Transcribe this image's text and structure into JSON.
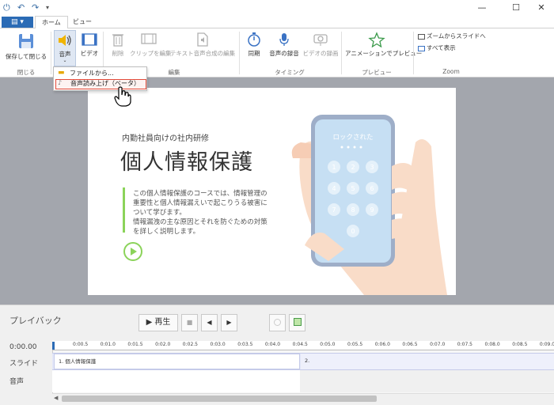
{
  "window": {
    "quick_access": [
      "⏻",
      "↶",
      "↷",
      "▾"
    ],
    "minimize": "—",
    "maximize": "☐",
    "close": "✕"
  },
  "tabs": {
    "file": "▤ ▾",
    "home": "ホーム",
    "view": "ビュー"
  },
  "ribbon": {
    "save_close": "保存して閉じる",
    "audio": "音声",
    "video": "ビデオ",
    "delete": "削除",
    "edit_clip": "クリップを編集",
    "tts_edit": "テキスト音声合成の編集",
    "sync": "同期",
    "record_audio": "音声の録音",
    "record_video": "ビデオの録画",
    "preview_animation": "アニメーションでプレビュー",
    "zoom_from_slide": "ズームからスライドへ",
    "show_all": "すべて表示",
    "groups": {
      "close": "閉じる",
      "edit": "編集",
      "timing": "タイミング",
      "preview": "プレビュー",
      "zoom": "Zoom"
    }
  },
  "dropdown": {
    "from_file": "ファイルから...",
    "tts_beta": "音声読み上げ（ベータ）"
  },
  "slide": {
    "subtitle": "内勤社員向けの社内研修",
    "title": "個人情報保護",
    "body": [
      "この個人情報保護のコースでは、情報管理の",
      "重要性と個人情報漏えいで起こりうる被害に",
      "ついて学びます。",
      "情報漏洩の主な原因とそれを防ぐための対策",
      "を詳しく説明します。"
    ],
    "phone_text": "ロックされた",
    "keypad": [
      "1",
      "2",
      "3",
      "4",
      "5",
      "6",
      "7",
      "8",
      "9",
      "0"
    ],
    "colors": {
      "accent": "#8bd35a"
    }
  },
  "playback": {
    "label": "プレイバック",
    "play": "▶ 再生",
    "stop": "■",
    "prev": "◀",
    "next": "▶",
    "time": "0:00.00",
    "row_slide": "スライド",
    "row_audio": "音声",
    "ticks": [
      "0:00.5",
      "0:01.0",
      "0:01.5",
      "0:02.0",
      "0:02.5",
      "0:03.0",
      "0:03.5",
      "0:04.0",
      "0:04.5",
      "0:05.0",
      "0:05.5",
      "0:06.0",
      "0:06.5",
      "0:07.0",
      "0:07.5",
      "0:08.0",
      "0:08.5",
      "0:09.0"
    ],
    "segment1": "1. 個人情報保護",
    "segment2": "2."
  }
}
